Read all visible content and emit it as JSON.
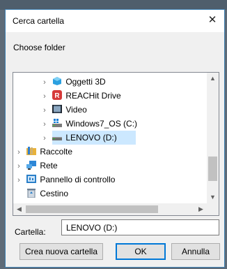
{
  "dialog": {
    "title": "Cerca cartella",
    "prompt": "Choose folder",
    "close_glyph": "✕"
  },
  "tree": {
    "items": [
      {
        "label": "Oggetti 3D",
        "icon": "objects-3d-icon",
        "chevron": "›",
        "level": 2,
        "selected": false
      },
      {
        "label": "REACHit Drive",
        "icon": "reachit-drive-icon",
        "chevron": "›",
        "level": 2,
        "selected": false
      },
      {
        "label": "Video",
        "icon": "video-folder-icon",
        "chevron": "›",
        "level": 2,
        "selected": false
      },
      {
        "label": "Windows7_OS (C:)",
        "icon": "windows-drive-icon",
        "chevron": "›",
        "level": 2,
        "selected": false
      },
      {
        "label": "LENOVO (D:)",
        "icon": "drive-icon",
        "chevron": "›",
        "level": 2,
        "selected": true
      },
      {
        "label": "Raccolte",
        "icon": "libraries-icon",
        "chevron": "›",
        "level": 1,
        "selected": false
      },
      {
        "label": "Rete",
        "icon": "network-icon",
        "chevron": "›",
        "level": 1,
        "selected": false
      },
      {
        "label": "Pannello di controllo",
        "icon": "control-panel-icon",
        "chevron": "›",
        "level": 1,
        "selected": false
      },
      {
        "label": "Cestino",
        "icon": "recycle-bin-icon",
        "chevron": "",
        "level": 1,
        "selected": false
      }
    ]
  },
  "folder_field": {
    "label": "Cartella:",
    "value": "LENOVO (D:)"
  },
  "buttons": {
    "new_folder": "Crea nuova cartella",
    "ok": "OK",
    "cancel": "Annulla"
  },
  "colors": {
    "selection": "#cce8ff",
    "default_button_border": "#0078d7"
  }
}
